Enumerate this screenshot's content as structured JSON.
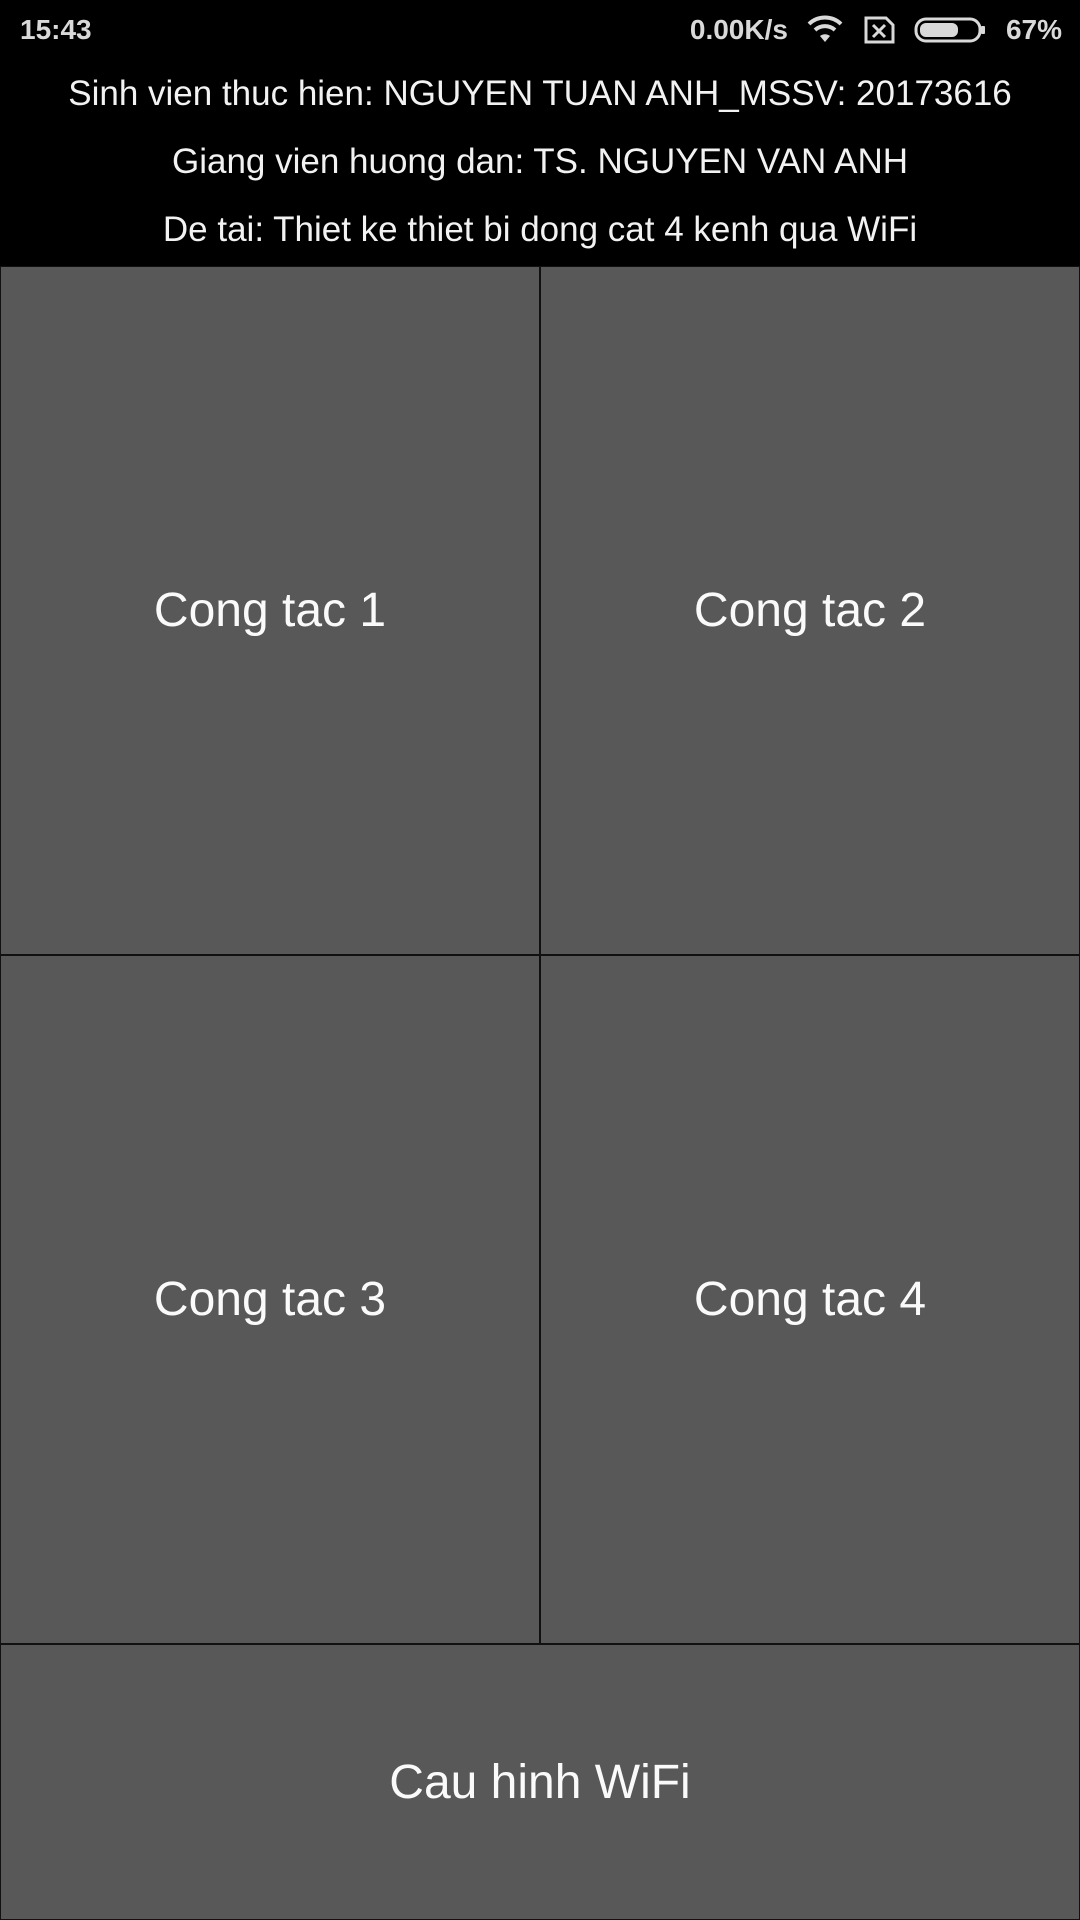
{
  "status_bar": {
    "time": "15:43",
    "network_speed": "0.00K/s",
    "battery_percent": "67%",
    "battery_level": 0.67,
    "icons": [
      "wifi-icon",
      "no-sim-icon",
      "battery-icon"
    ]
  },
  "header": {
    "student_line": "Sinh vien thuc hien: NGUYEN TUAN ANH_MSSV: 20173616",
    "advisor_line": "Giang vien huong dan: TS. NGUYEN VAN ANH",
    "topic_line": "De tai: Thiet ke thiet bi dong cat 4 kenh qua WiFi"
  },
  "switches": [
    {
      "label": "Cong tac 1"
    },
    {
      "label": "Cong tac 2"
    },
    {
      "label": "Cong tac 3"
    },
    {
      "label": "Cong tac 4"
    }
  ],
  "wifi_config": {
    "label": "Cau hinh WiFi"
  },
  "colors": {
    "background": "#000000",
    "button_bg": "#585858",
    "text": "#ffffff"
  }
}
